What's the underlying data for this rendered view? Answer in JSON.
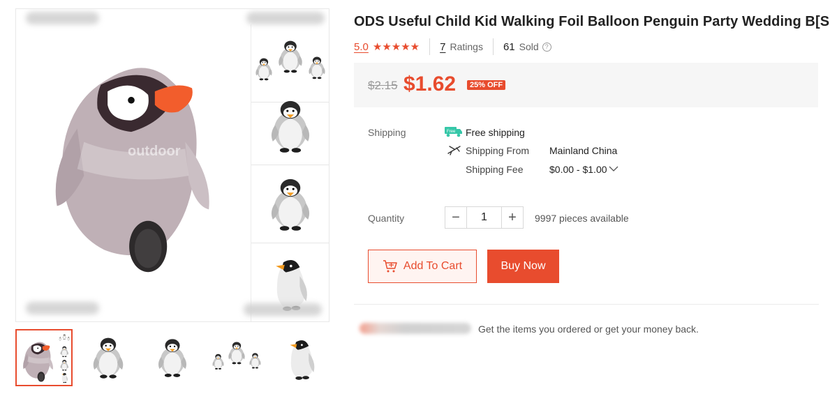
{
  "product": {
    "title": "ODS Useful Child Kid Walking Foil Balloon Penguin Party Wedding B[SG]",
    "rating": "5.0",
    "stars": 5,
    "ratings_count": "7",
    "ratings_label": "Ratings",
    "sold_count": "61",
    "sold_label": "Sold"
  },
  "price": {
    "original": "$2.15",
    "current": "$1.62",
    "discount": "25% OFF"
  },
  "shipping": {
    "label": "Shipping",
    "free_text": "Free shipping",
    "free_badge": "Free",
    "from_label": "Shipping From",
    "from_value": "Mainland China",
    "fee_label": "Shipping Fee",
    "fee_value": "$0.00 - $1.00"
  },
  "quantity": {
    "label": "Quantity",
    "value": "1",
    "available": "9997 pieces available",
    "minus": "−",
    "plus": "+"
  },
  "actions": {
    "add_to_cart": "Add To Cart",
    "buy_now": "Buy Now"
  },
  "guarantee": {
    "text": "Get the items you ordered or get your money back."
  },
  "gallery": {
    "main_watermark": "outdoor",
    "thumbnails_count": 5,
    "selected_thumbnail": 0
  },
  "colors": {
    "accent": "#e84c2e",
    "price_bg": "#f6f6f6"
  },
  "icons": {
    "rating": "star-icon",
    "help": "question-circle-icon",
    "free_shipping": "truck-icon",
    "ship_from": "plane-icon",
    "fee_dropdown": "chevron-down-icon",
    "cart": "cart-icon"
  }
}
